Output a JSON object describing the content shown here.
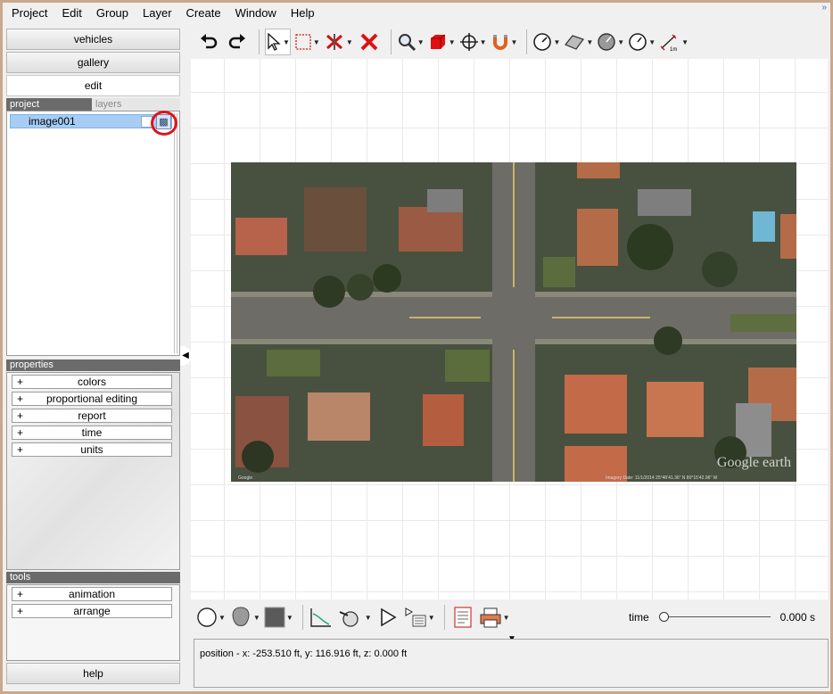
{
  "menu": {
    "items": [
      "Project",
      "Edit",
      "Group",
      "Layer",
      "Create",
      "Window",
      "Help"
    ]
  },
  "left_panel": {
    "nav": {
      "vehicles": "vehicles",
      "gallery": "gallery",
      "edit": "edit"
    },
    "tabs": {
      "project": "project",
      "layers": "layers"
    },
    "project_items": [
      {
        "label": "image001",
        "selected": true
      }
    ],
    "properties": {
      "header": "properties",
      "rows": [
        "colors",
        "proportional editing",
        "report",
        "time",
        "units"
      ]
    },
    "tools": {
      "header": "tools",
      "rows": [
        "animation",
        "arrange"
      ]
    },
    "help": "help",
    "expander_symbol": "+"
  },
  "toolbar": {
    "icons": [
      "undo-icon",
      "redo-icon",
      "select-arrow-icon",
      "selection-box-icon",
      "delete-point-icon",
      "delete-icon",
      "zoom-icon",
      "3d-box-icon",
      "move-icon",
      "magnet-icon",
      "measure-angle-icon",
      "surface-icon",
      "disc-icon",
      "speedometer-icon",
      "scale-icon"
    ]
  },
  "bottom_toolbar": {
    "icons": [
      "circle-icon",
      "shape-icon",
      "color-swatch-icon",
      "graph-icon",
      "camera-icon",
      "play-icon",
      "render-icon",
      "report-icon",
      "print-icon"
    ],
    "time_label": "time",
    "time_value": "0.000 s",
    "time_fraction": 0
  },
  "canvas": {
    "image_watermark": "Google earth",
    "image_credits": "Imagery Date: 11/1/2014    25°46'41.36\" N    80°15'42.96\" W"
  },
  "status": {
    "text": "position - x: -253.510 ft, y: 116.916 ft, z: 0.000 ft"
  },
  "colors": {
    "frame": "#c9a88c",
    "selection": "#a7cdf4",
    "annotation_circle": "#e0141b"
  }
}
